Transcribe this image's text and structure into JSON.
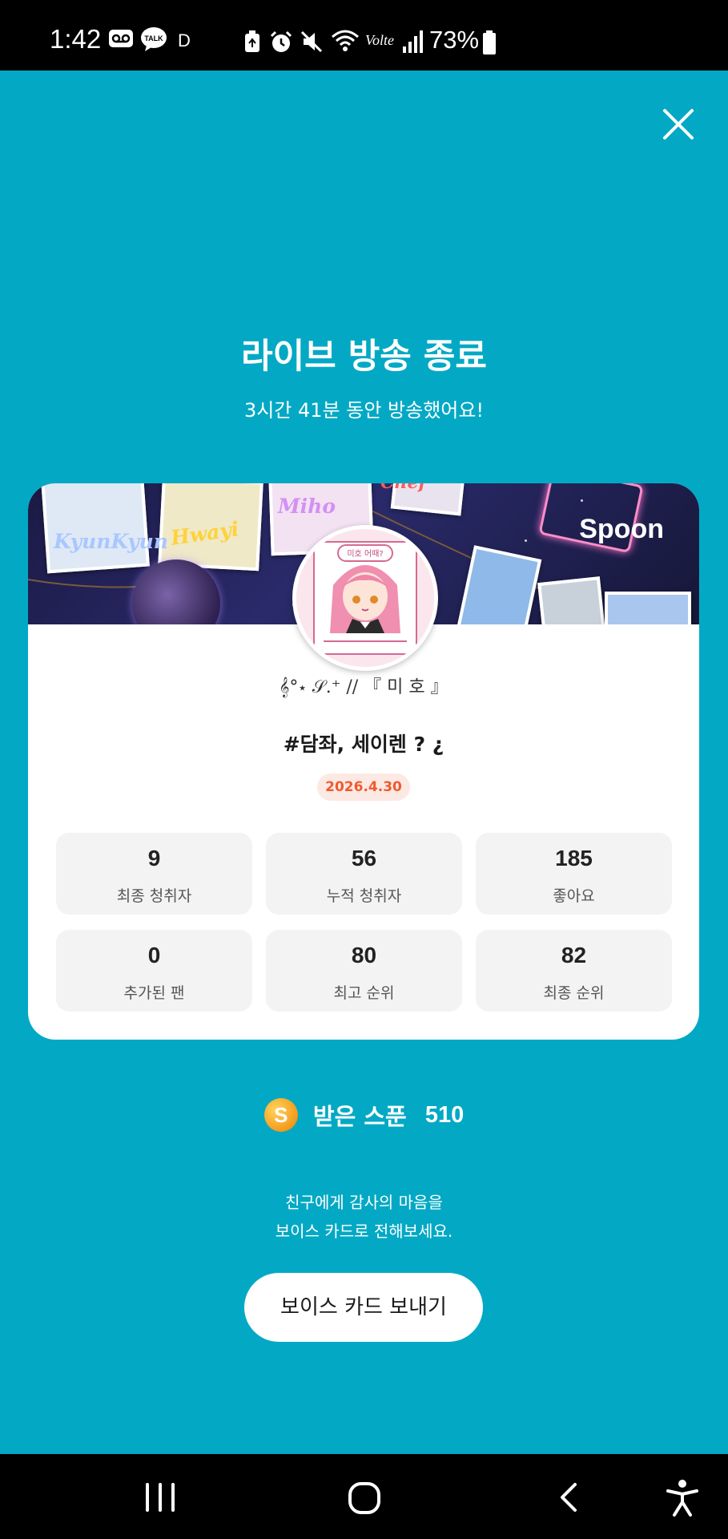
{
  "status_bar": {
    "time": "1:42",
    "talk_icon_text": "TALK",
    "d_indicator": "D",
    "volte": "Volte",
    "battery_percent": "73%"
  },
  "header": {
    "title": "라이브 방송 종료",
    "subtitle": "3시간 41분 동안 방송했어요!"
  },
  "card": {
    "banner_logo": "Spoon",
    "banner_labels": [
      "KyunKyun",
      "Hwayi",
      "Miho",
      "Chef"
    ],
    "avatar_bubble": "미호 어때?",
    "nickname": "𝄞°⋆ 𝒮.⁺ // 『 미 호 』",
    "live_title": "#담좌, 세이렌 ? ¿",
    "date": "2026.4.30",
    "stats": [
      {
        "value": "9",
        "label": "최종 청취자"
      },
      {
        "value": "56",
        "label": "누적 청취자"
      },
      {
        "value": "185",
        "label": "좋아요"
      },
      {
        "value": "0",
        "label": "추가된 팬"
      },
      {
        "value": "80",
        "label": "최고 순위"
      },
      {
        "value": "82",
        "label": "최종 순위"
      }
    ]
  },
  "spoon": {
    "coin_letter": "S",
    "label": "받은 스푼",
    "count": "510"
  },
  "thanks": {
    "line1": "친구에게 감사의 마음을",
    "line2": "보이스 카드로 전해보세요."
  },
  "voice_card_button": "보이스 카드 보내기",
  "colors": {
    "background": "#03a9c4",
    "date_badge_bg": "#fde9e4",
    "date_badge_text": "#ef5a2e",
    "stat_bg": "#f3f3f3"
  },
  "icons": [
    "voicemail-icon",
    "kakaotalk-icon",
    "battery-saver-icon",
    "alarm-icon",
    "mute-icon",
    "wifi-icon",
    "signal-icon",
    "battery-icon",
    "close-icon",
    "recents-icon",
    "home-icon",
    "back-icon",
    "accessibility-icon"
  ]
}
